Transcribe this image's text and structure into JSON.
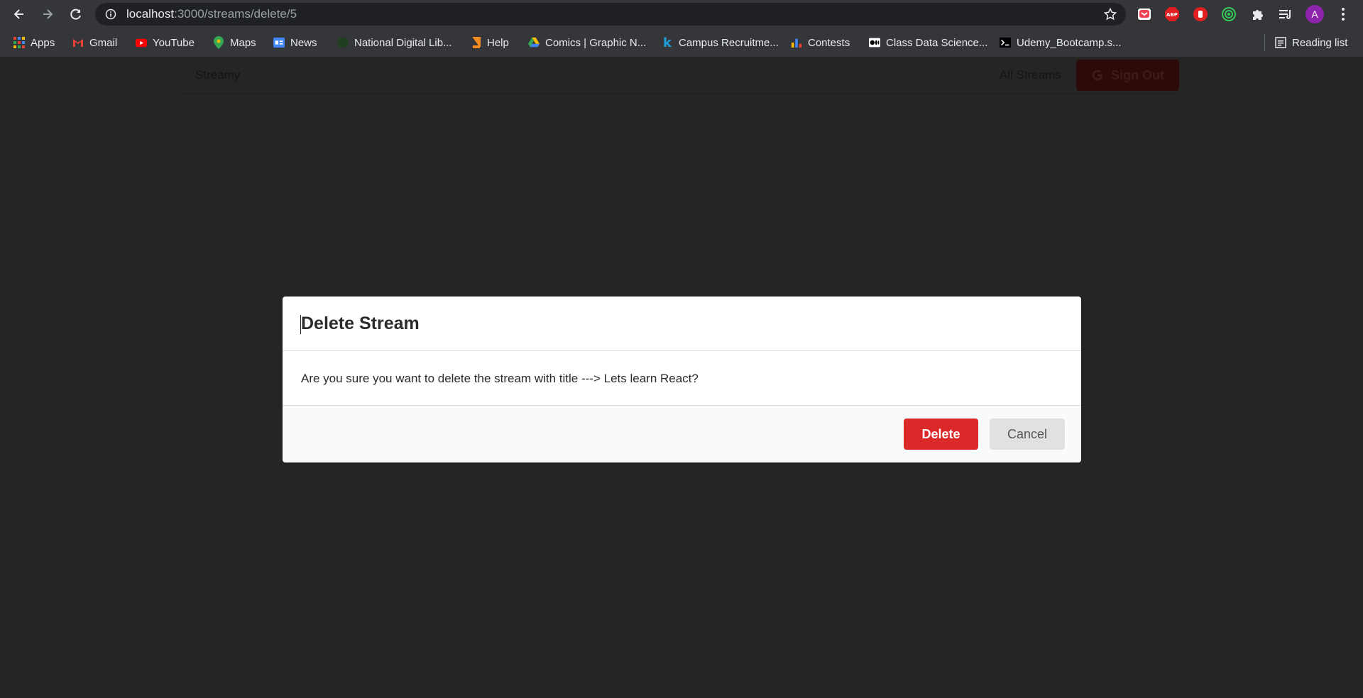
{
  "browser": {
    "url_host": "localhost",
    "url_path": ":3000/streams/delete/5",
    "avatar_letter": "A",
    "extensions": [
      "pocket-icon",
      "adblock-icon",
      "hand-icon",
      "circle-target-icon",
      "puzzle-icon",
      "reading-queue-icon"
    ]
  },
  "bookmarks": [
    {
      "label": "Apps",
      "icon": "apps-grid-icon"
    },
    {
      "label": "Gmail",
      "icon": "gmail-icon"
    },
    {
      "label": "YouTube",
      "icon": "youtube-icon"
    },
    {
      "label": "Maps",
      "icon": "maps-icon"
    },
    {
      "label": "News",
      "icon": "news-icon"
    },
    {
      "label": "National Digital Lib...",
      "icon": "globe-icon"
    },
    {
      "label": "Help",
      "icon": "book-icon"
    },
    {
      "label": "Comics | Graphic N...",
      "icon": "drive-icon"
    },
    {
      "label": "Campus Recruitme...",
      "icon": "k-icon"
    },
    {
      "label": "Contests",
      "icon": "bar-chart-icon"
    },
    {
      "label": "Class Data Science...",
      "icon": "medium-icon"
    },
    {
      "label": "Udemy_Bootcamp.s...",
      "icon": "terminal-icon"
    }
  ],
  "reading_list_label": "Reading list",
  "app": {
    "brand": "Streamy",
    "all_streams": "All Streams",
    "sign_out": "Sign Out"
  },
  "modal": {
    "title": "Delete Stream",
    "message": "Are you sure you want to delete the stream with title ---> Lets learn React?",
    "delete_label": "Delete",
    "cancel_label": "Cancel"
  },
  "colors": {
    "delete": "#db2828",
    "cancel": "#e0e1e2",
    "page_dim": "#252525"
  }
}
